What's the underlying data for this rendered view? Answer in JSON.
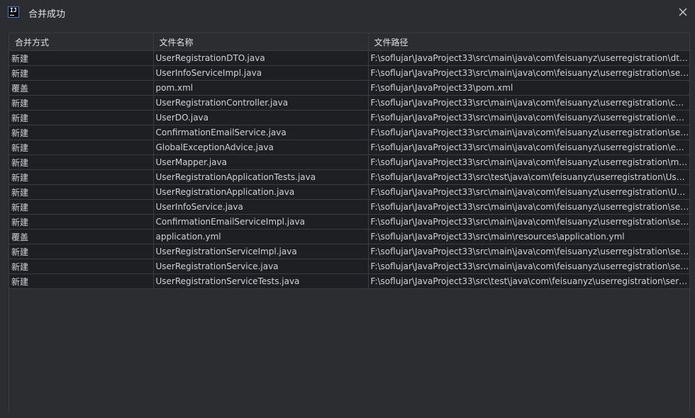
{
  "window": {
    "title": "合并成功",
    "app_icon_text": "IJ",
    "close_icon": "close-icon"
  },
  "table": {
    "columns": [
      "合并方式",
      "文件名称",
      "文件路径"
    ],
    "rows": [
      {
        "mode": "新建",
        "name": "UserRegistrationDTO.java",
        "path": "F:\\soflujar\\JavaProject33\\src\\main\\java\\com\\feisuanyz\\userregistration\\dto..."
      },
      {
        "mode": "新建",
        "name": "UserInfoServiceImpl.java",
        "path": "F:\\soflujar\\JavaProject33\\src\\main\\java\\com\\feisuanyz\\userregistration\\ser..."
      },
      {
        "mode": "覆盖",
        "name": "pom.xml",
        "path": "F:\\soflujar\\JavaProject33\\pom.xml"
      },
      {
        "mode": "新建",
        "name": "UserRegistrationController.java",
        "path": "F:\\soflujar\\JavaProject33\\src\\main\\java\\com\\feisuanyz\\userregistration\\con..."
      },
      {
        "mode": "新建",
        "name": "UserDO.java",
        "path": "F:\\soflujar\\JavaProject33\\src\\main\\java\\com\\feisuanyz\\userregistration\\enti..."
      },
      {
        "mode": "新建",
        "name": "ConfirmationEmailService.java",
        "path": "F:\\soflujar\\JavaProject33\\src\\main\\java\\com\\feisuanyz\\userregistration\\ser..."
      },
      {
        "mode": "新建",
        "name": "GlobalExceptionAdvice.java",
        "path": "F:\\soflujar\\JavaProject33\\src\\main\\java\\com\\feisuanyz\\userregistration\\exc..."
      },
      {
        "mode": "新建",
        "name": "UserMapper.java",
        "path": "F:\\soflujar\\JavaProject33\\src\\main\\java\\com\\feisuanyz\\userregistration\\ma..."
      },
      {
        "mode": "新建",
        "name": "UserRegistrationApplicationTests.java",
        "path": "F:\\soflujar\\JavaProject33\\src\\test\\java\\com\\feisuanyz\\userregistration\\User..."
      },
      {
        "mode": "新建",
        "name": "UserRegistrationApplication.java",
        "path": "F:\\soflujar\\JavaProject33\\src\\main\\java\\com\\feisuanyz\\userregistration\\Use..."
      },
      {
        "mode": "新建",
        "name": "UserInfoService.java",
        "path": "F:\\soflujar\\JavaProject33\\src\\main\\java\\com\\feisuanyz\\userregistration\\ser..."
      },
      {
        "mode": "新建",
        "name": "ConfirmationEmailServiceImpl.java",
        "path": "F:\\soflujar\\JavaProject33\\src\\main\\java\\com\\feisuanyz\\userregistration\\ser..."
      },
      {
        "mode": "覆盖",
        "name": "application.yml",
        "path": "F:\\soflujar\\JavaProject33\\src\\main\\resources\\application.yml"
      },
      {
        "mode": "新建",
        "name": "UserRegistrationServiceImpl.java",
        "path": "F:\\soflujar\\JavaProject33\\src\\main\\java\\com\\feisuanyz\\userregistration\\ser..."
      },
      {
        "mode": "新建",
        "name": "UserRegistrationService.java",
        "path": "F:\\soflujar\\JavaProject33\\src\\main\\java\\com\\feisuanyz\\userregistration\\ser..."
      },
      {
        "mode": "新建",
        "name": "UserRegistrationServiceTests.java",
        "path": "F:\\soflujar\\JavaProject33\\src\\test\\java\\com\\feisuanyz\\userregistration\\servi..."
      }
    ]
  },
  "colors": {
    "background": "#2b2d30",
    "row_background": "#1e1f22",
    "grid": "#3a3d41",
    "text": "#cfd2d6",
    "icon_border": "#3c7bd6"
  }
}
